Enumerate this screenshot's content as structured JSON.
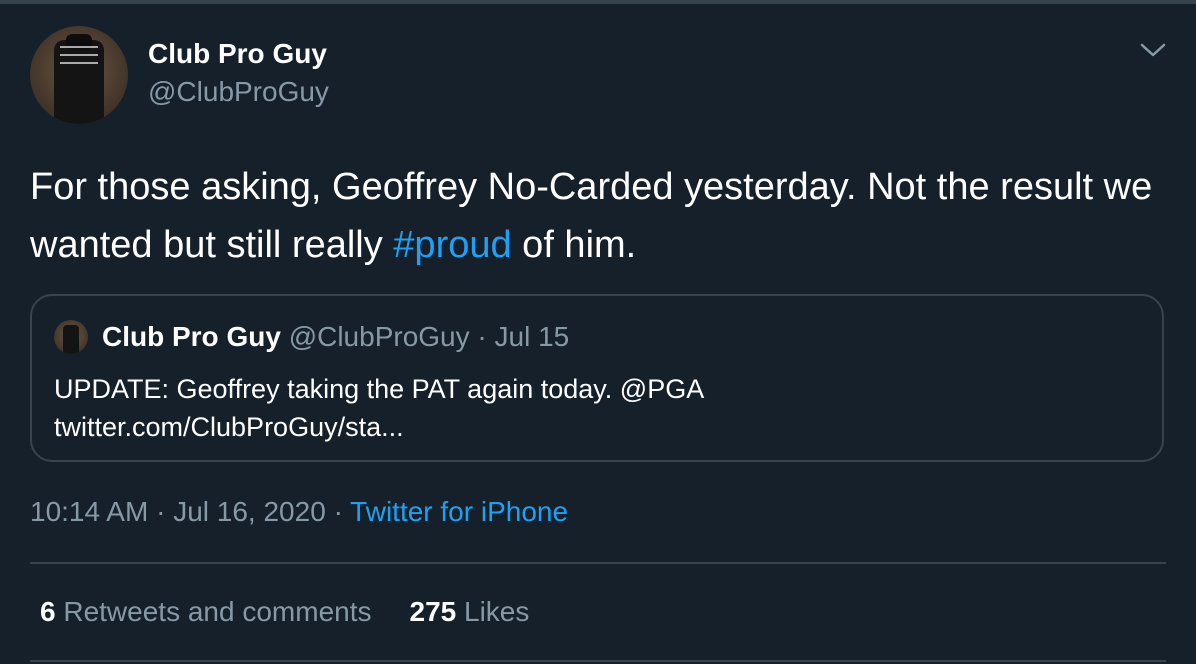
{
  "author": {
    "display_name": "Club Pro Guy",
    "handle": "@ClubProGuy",
    "avatar": "profile-photo"
  },
  "menu": {
    "icon": "chevron-down-icon"
  },
  "tweet": {
    "text_before": "For those asking, Geoffrey No-Carded yesterday. Not the result we wanted but still really ",
    "hashtag": "#proud",
    "text_after": " of him."
  },
  "quoted_tweet": {
    "display_name": "Club Pro Guy",
    "handle": "@ClubProGuy",
    "separator": "·",
    "date": "Jul 15",
    "line1": "UPDATE: Geoffrey taking the PAT again today. @PGA",
    "line2": "twitter.com/ClubProGuy/sta..."
  },
  "meta": {
    "time": "10:14 AM",
    "separator": "·",
    "date": "Jul 16, 2020",
    "source": "Twitter for iPhone"
  },
  "stats": {
    "retweets_count": "6",
    "retweets_label": "Retweets and comments",
    "likes_count": "275",
    "likes_label": "Likes"
  },
  "colors": {
    "background": "#15202b",
    "accent": "#1da1f2",
    "secondary_text": "#8899a6",
    "border": "#38444d"
  }
}
